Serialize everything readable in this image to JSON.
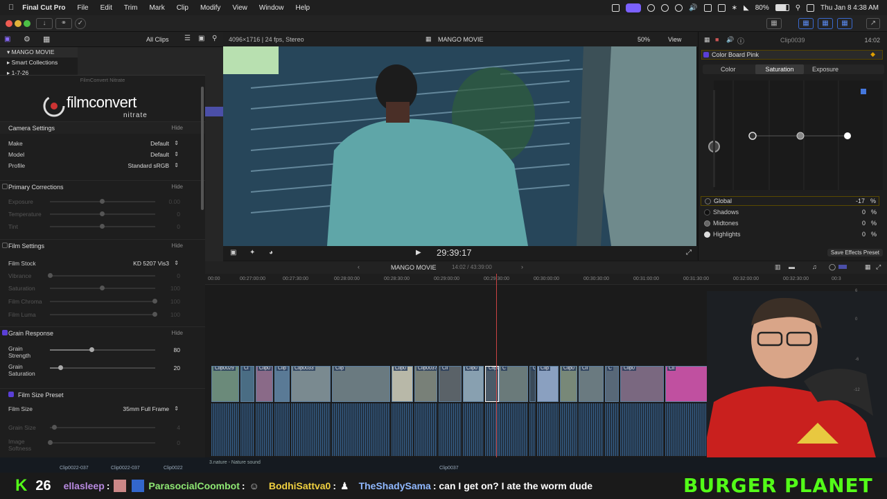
{
  "menubar": {
    "app": "Final Cut Pro",
    "items": [
      "File",
      "Edit",
      "Trim",
      "Mark",
      "Clip",
      "Modify",
      "View",
      "Window",
      "Help"
    ],
    "battery": "80%",
    "datetime": "Thu Jan 8  4:38 AM"
  },
  "browser": {
    "filter": "All Clips",
    "library": "MANGO MOVIE",
    "tree": [
      "Smart Collections",
      "1-7-26"
    ]
  },
  "viewer": {
    "format": "4096×1716 | 24 fps, Stereo",
    "title": "MANGO MOVIE",
    "zoom": "50%",
    "view": "View",
    "timecode": "29:39:17"
  },
  "inspector": {
    "plugin": "FilmConvert Nitrate",
    "logo_main": "filmconvert",
    "logo_sub": "nitrate",
    "camera": {
      "title": "Camera Settings",
      "hide": "Hide",
      "make_label": "Make",
      "make": "Default",
      "model_label": "Model",
      "model": "Default",
      "profile_label": "Profile",
      "profile": "Standard sRGB"
    },
    "primary": {
      "title": "Primary Corrections",
      "hide": "Hide",
      "exposure": "Exposure",
      "exposure_val": "0.00",
      "temperature": "Temperature",
      "temperature_val": "0",
      "tint": "Tint",
      "tint_val": "0"
    },
    "film": {
      "title": "Film Settings",
      "hide": "Hide",
      "stock_label": "Film Stock",
      "stock": "KD 5207 Vis3",
      "vibrance": "Vibrance",
      "vibrance_val": "0",
      "saturation": "Saturation",
      "saturation_val": "100",
      "chroma": "Film Chroma",
      "chroma_val": "100",
      "luma": "Film Luma",
      "luma_val": "100"
    },
    "grain": {
      "title": "Grain Response",
      "hide": "Hide",
      "strength_label": "Grain Strength",
      "strength": "80",
      "saturation_label": "Grain Saturation",
      "saturation": "20"
    },
    "size": {
      "title": "Film Size Preset",
      "size_label": "Film Size",
      "size": "35mm Full Frame",
      "grain_size": "Grain Size",
      "grain_size_val": "4",
      "softness": "Image Softness",
      "softness_val": "0"
    }
  },
  "colorboard": {
    "clip": "Clip0039",
    "duration": "14:02",
    "preset": "Color Board Pink",
    "tabs": [
      "Color",
      "Saturation",
      "Exposure"
    ],
    "active_tab": "Saturation",
    "rows": [
      {
        "name": "Global",
        "value": "-17",
        "unit": "%"
      },
      {
        "name": "Shadows",
        "value": "0",
        "unit": "%"
      },
      {
        "name": "Midtones",
        "value": "0",
        "unit": "%"
      },
      {
        "name": "Highlights",
        "value": "0",
        "unit": "%"
      }
    ],
    "save": "Save Effects Preset"
  },
  "timeline": {
    "project": "MANGO MOVIE",
    "position": "14:02 / 43:39:00",
    "ruler": [
      "00:00",
      "00:27:00:00",
      "00:27:30:00",
      "00:28:00:00",
      "00:28:30:00",
      "00:29:00:00",
      "00:29:30:00",
      "00:30:00:00",
      "00:30:30:00",
      "00:31:00:00",
      "00:31:30:00",
      "00:32:00:00",
      "00:32:30:00",
      "00:3"
    ],
    "clips": [
      "Clip0029",
      "Cl",
      "Clip0",
      "Clip",
      "Clip0033",
      "Clip",
      "Clip0",
      "Clip0037",
      "Cli",
      "Clip0",
      "Clip0040",
      "C",
      "Cli",
      "Clip",
      "Clip0",
      "Cli",
      "C",
      "Clip0",
      "Cli",
      "Clip0003"
    ],
    "audio_label": "3.nature - Nature sound",
    "bottom_clips": [
      "Clip0022-037",
      "Clip0022-037",
      "Clip0022",
      "Clip0037"
    ],
    "meter": [
      "6",
      "0",
      "-6",
      "-12"
    ]
  },
  "stream": {
    "k_count": "26",
    "msgs": [
      {
        "user": "ellasleep",
        "text": ":"
      },
      {
        "user": "ParasocialCoombot",
        "text": ":"
      },
      {
        "user": "BodhiSattva0",
        "text": ":"
      },
      {
        "user": "TheShadySama",
        "text": ": can I get on? I ate the worm dude"
      }
    ],
    "banner": "BURGER PLANET"
  }
}
